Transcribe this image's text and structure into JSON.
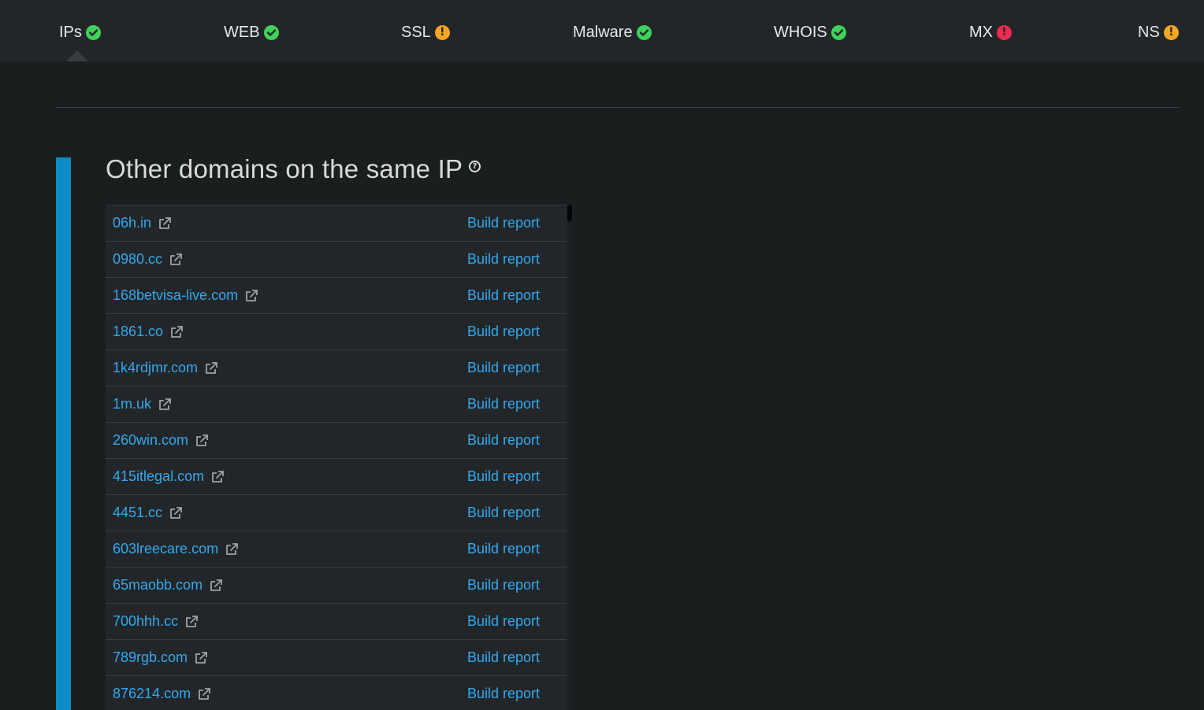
{
  "tabs": [
    {
      "label": "IPs",
      "status": "ok",
      "icon": "check-circle-icon"
    },
    {
      "label": "WEB",
      "status": "ok",
      "icon": "check-circle-icon"
    },
    {
      "label": "SSL",
      "status": "warn",
      "icon": "exclamation-circle-icon"
    },
    {
      "label": "Malware",
      "status": "ok",
      "icon": "check-circle-icon"
    },
    {
      "label": "WHOIS",
      "status": "ok",
      "icon": "check-circle-icon"
    },
    {
      "label": "MX",
      "status": "error",
      "icon": "exclamation-circle-icon"
    },
    {
      "label": "NS",
      "status": "warn",
      "icon": "exclamation-circle-icon"
    }
  ],
  "active_tab": "IPs",
  "section": {
    "title": "Other domains on the same IP",
    "help_icon": "question-circle-icon"
  },
  "domains": [
    {
      "name": "06h.in",
      "action": "Build report"
    },
    {
      "name": "0980.cc",
      "action": "Build report"
    },
    {
      "name": "168betvisa-live.com",
      "action": "Build report"
    },
    {
      "name": "1861.co",
      "action": "Build report"
    },
    {
      "name": "1k4rdjmr.com",
      "action": "Build report"
    },
    {
      "name": "1m.uk",
      "action": "Build report"
    },
    {
      "name": "260win.com",
      "action": "Build report"
    },
    {
      "name": "415itlegal.com",
      "action": "Build report"
    },
    {
      "name": "4451.cc",
      "action": "Build report"
    },
    {
      "name": "603lreecare.com",
      "action": "Build report"
    },
    {
      "name": "65maobb.com",
      "action": "Build report"
    },
    {
      "name": "700hhh.cc",
      "action": "Build report"
    },
    {
      "name": "789rgb.com",
      "action": "Build report"
    },
    {
      "name": "876214.com",
      "action": "Build report"
    }
  ],
  "colors": {
    "background": "#1b1e1f",
    "panel": "#222628",
    "accent": "#0b8bc7",
    "link": "#32a8f0",
    "ok": "#3fd25b",
    "warn": "#f5a623",
    "error": "#ec2c4f"
  }
}
